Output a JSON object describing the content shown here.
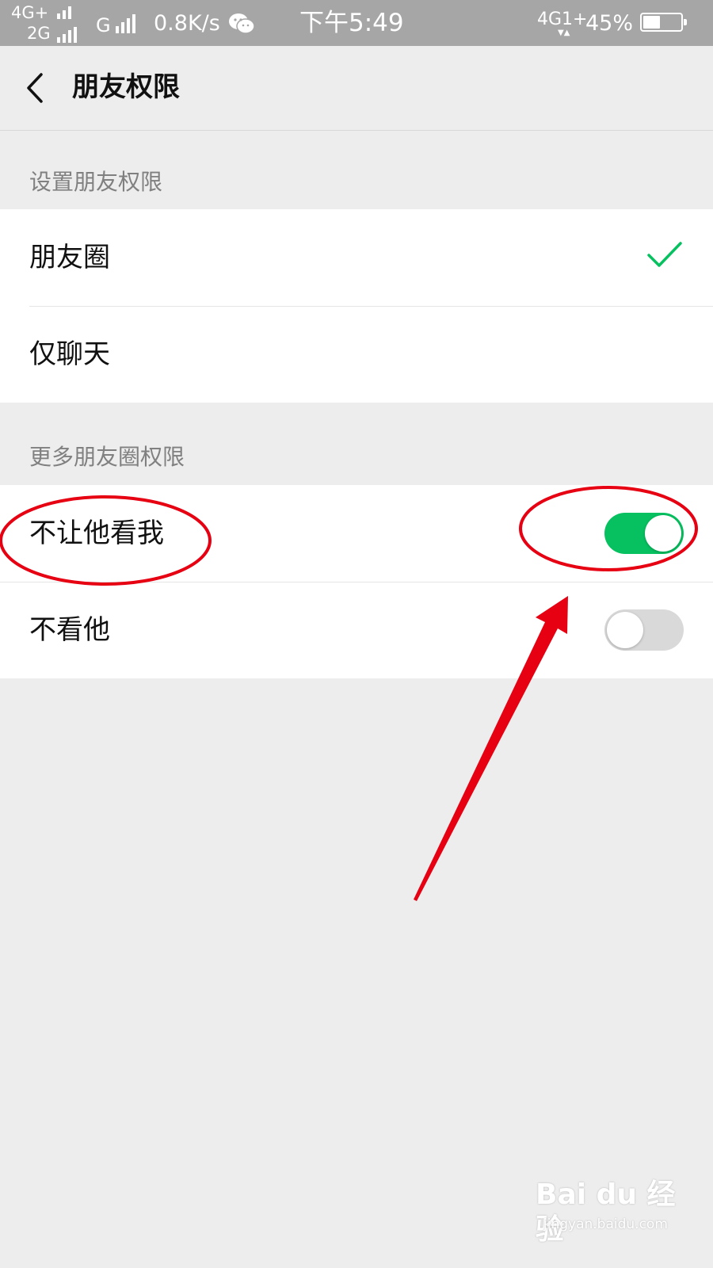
{
  "status_bar": {
    "network_1": "4G+",
    "network_2": "2G",
    "network_3": "G",
    "speed": "0.8K/s",
    "time": "下午5:49",
    "network_4": "4G1+",
    "battery": "45%",
    "battery_level": 0.45,
    "app_icon": "wechat-icon"
  },
  "nav": {
    "back_icon": "chevron-left-icon",
    "title": "朋友权限"
  },
  "section_1": {
    "header": "设置朋友权限",
    "items": [
      {
        "label": "朋友圈",
        "checked": true
      },
      {
        "label": "仅聊天",
        "checked": false
      }
    ]
  },
  "section_2": {
    "header": "更多朋友圈权限",
    "items": [
      {
        "label": "不让他看我",
        "toggle_on": true
      },
      {
        "label": "不看他",
        "toggle_on": false
      }
    ]
  },
  "colors": {
    "accent_green": "#07c160",
    "annotation_red": "#e60012",
    "background": "#ededed"
  },
  "watermark": {
    "brand": "Bai du 经验",
    "url": "jingyan.baidu.com"
  }
}
